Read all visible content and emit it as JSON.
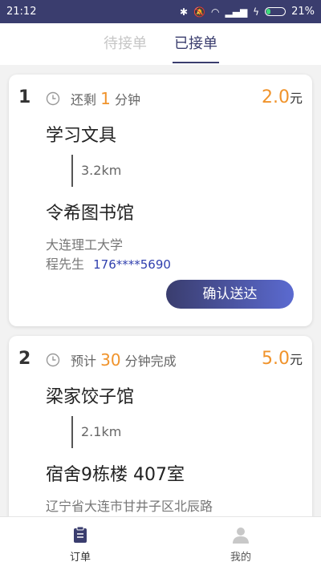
{
  "status": {
    "time": "21:12",
    "battery": "21%",
    "battery_level": 0.21
  },
  "tabs": [
    {
      "label": "待接单"
    },
    {
      "label": "已接单"
    }
  ],
  "orders": [
    {
      "index": "1",
      "time_prefix": "还剩",
      "time_value": "1",
      "time_suffix": "分钟",
      "price": "2.0",
      "currency": "元",
      "from": "学习文具",
      "distance": "3.2km",
      "to": "令希图书馆",
      "address": "大连理工大学",
      "customer": "程先生",
      "phone": "176****5690",
      "action_label": "确认送达"
    },
    {
      "index": "2",
      "time_prefix": "预计",
      "time_value": "30",
      "time_suffix": "分钟完成",
      "price": "5.0",
      "currency": "元",
      "from": "梁家饺子馆",
      "distance": "2.1km",
      "to": "宿舍9栋楼 407室",
      "address": "辽宁省大连市甘井子区北辰路"
    }
  ],
  "nav": [
    {
      "label": "订单",
      "icon": "clipboard-icon"
    },
    {
      "label": "我的",
      "icon": "person-icon"
    }
  ],
  "colors": {
    "primary": "#3a3d6e",
    "accent": "#f0932b",
    "phone": "#2f3fae"
  }
}
